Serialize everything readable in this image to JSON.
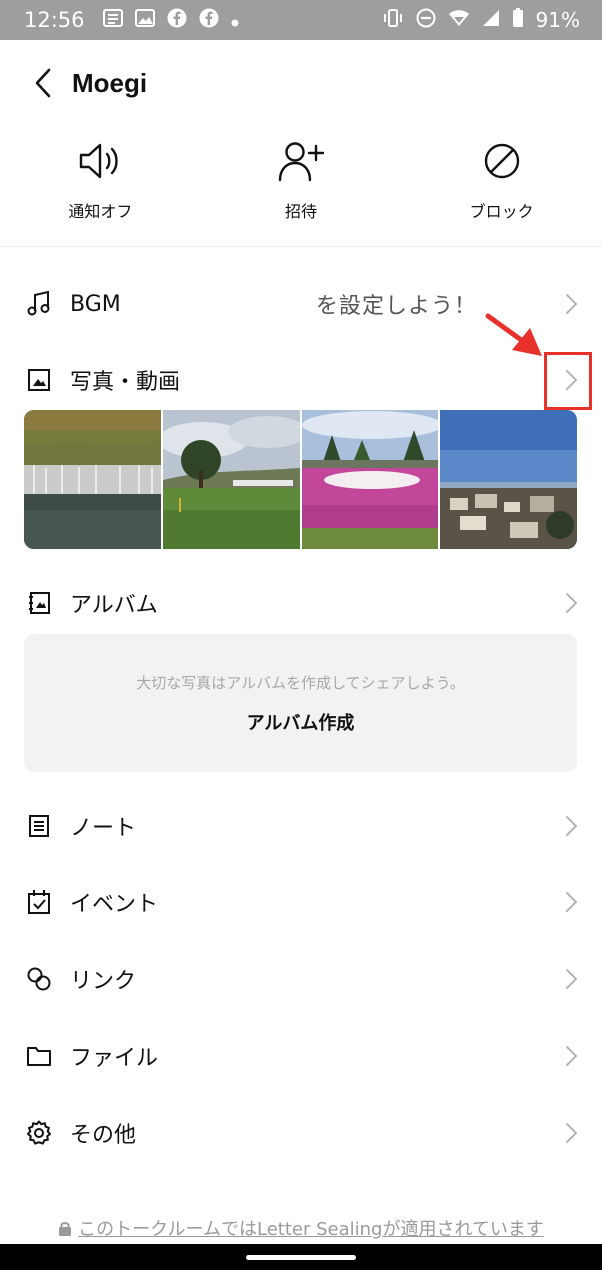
{
  "status_bar": {
    "time": "12:56",
    "battery": "91%",
    "icons_left": [
      "news-icon",
      "image-icon",
      "facebook-icon",
      "facebook-icon",
      "dot-icon"
    ],
    "icons_right": [
      "vibrate-icon",
      "do-not-disturb-icon",
      "wifi-icon",
      "signal-icon",
      "battery-icon"
    ],
    "background": "#9e9e9e"
  },
  "header": {
    "title": "Moegi"
  },
  "actions": [
    {
      "label": "通知オフ",
      "icon": "speaker-icon"
    },
    {
      "label": "招待",
      "icon": "add-user-icon"
    },
    {
      "label": "ブロック",
      "icon": "block-icon"
    }
  ],
  "rows": {
    "bgm": {
      "label": "BGM",
      "promo": "を設定しよう！",
      "icon": "music-note-icon"
    },
    "photos": {
      "label": "写真・動画",
      "icon": "photo-icon"
    },
    "album": {
      "label": "アルバム",
      "icon": "album-icon"
    },
    "note": {
      "label": "ノート",
      "icon": "note-icon"
    },
    "event": {
      "label": "イベント",
      "icon": "calendar-check-icon"
    },
    "link": {
      "label": "リンク",
      "icon": "link-icon"
    },
    "file": {
      "label": "ファイル",
      "icon": "folder-icon"
    },
    "other": {
      "label": "その他",
      "icon": "gear-icon"
    }
  },
  "album_empty": {
    "hint": "大切な写真はアルバムを作成してシェアしよう。",
    "create_label": "アルバム作成"
  },
  "photos": [
    {
      "subject": "waterfall"
    },
    {
      "subject": "park-field"
    },
    {
      "subject": "pink-flower-field"
    },
    {
      "subject": "town-view"
    }
  ],
  "footer": {
    "note": "このトークルームではLetter Sealingが適用されています"
  },
  "colors": {
    "accent_red": "#e8312a",
    "chevron": "#b5b5b5"
  }
}
